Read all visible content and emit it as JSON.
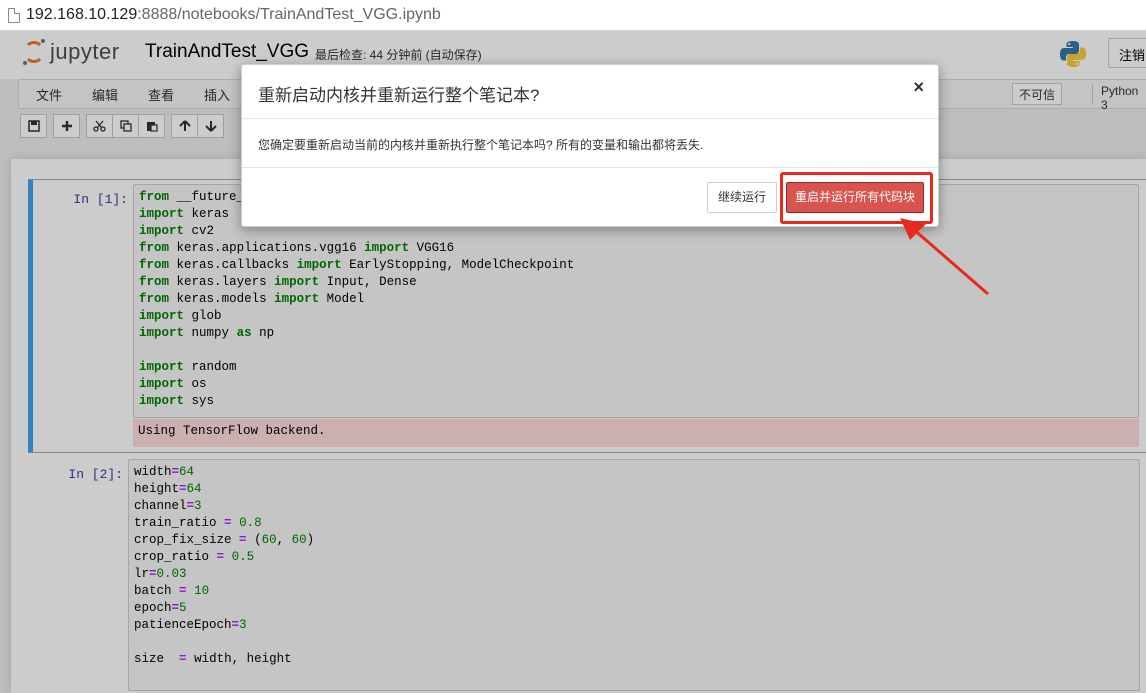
{
  "address_bar": {
    "host": "192.168.10.129",
    "rest": ":8888/notebooks/TrainAndTest_VGG.ipynb"
  },
  "header": {
    "logo_text": "jupyter",
    "notebook_title": "TrainAndTest_VGG",
    "checkpoint": "最后检查: 44 分钟前 (自动保存)",
    "logout_label": "注销"
  },
  "menubar": {
    "items": [
      "文件",
      "编辑",
      "查看",
      "插入"
    ],
    "trust_label": "不可信",
    "kernel_label": "Python 3"
  },
  "toolbar": {
    "icons": [
      "save-icon",
      "plus-icon",
      "cut-icon",
      "copy-icon",
      "paste-icon",
      "arrow-up-icon",
      "arrow-down-icon"
    ]
  },
  "cells": [
    {
      "prompt": "In  [1]:",
      "lines": [
        "from __future__",
        "import keras",
        "import cv2",
        "from keras.applications.vgg16 import VGG16",
        "from keras.callbacks import EarlyStopping, ModelCheckpoint",
        "from keras.layers import Input, Dense",
        "from keras.models import Model",
        "import glob",
        "import numpy as np",
        "",
        "import random",
        "import os",
        "import sys"
      ],
      "output": "Using TensorFlow backend."
    },
    {
      "prompt": "In  [2]:",
      "lines": [
        "width=64",
        "height=64",
        "channel=3",
        "train_ratio = 0.8",
        "crop_fix_size = (60, 60)",
        "crop_ratio = 0.5",
        "lr=0.03",
        "batch = 10",
        "epoch=5",
        "patienceEpoch=3",
        "",
        "size  = width, height"
      ]
    }
  ],
  "dialog": {
    "title": "重新启动内核并重新运行整个笔记本?",
    "close": "×",
    "body": "您确定要重新启动当前的内核并重新执行整个笔记本吗? 所有的变量和输出都将丢失.",
    "continue_label": "继续运行",
    "restart_label": "重启并运行所有代码块"
  },
  "colors": {
    "restart_button": "#d9534f",
    "highlight": "#e8291c",
    "selected_cell_border": "#42a5f5",
    "prompt": "#303f9f",
    "keyword": "#008000"
  }
}
